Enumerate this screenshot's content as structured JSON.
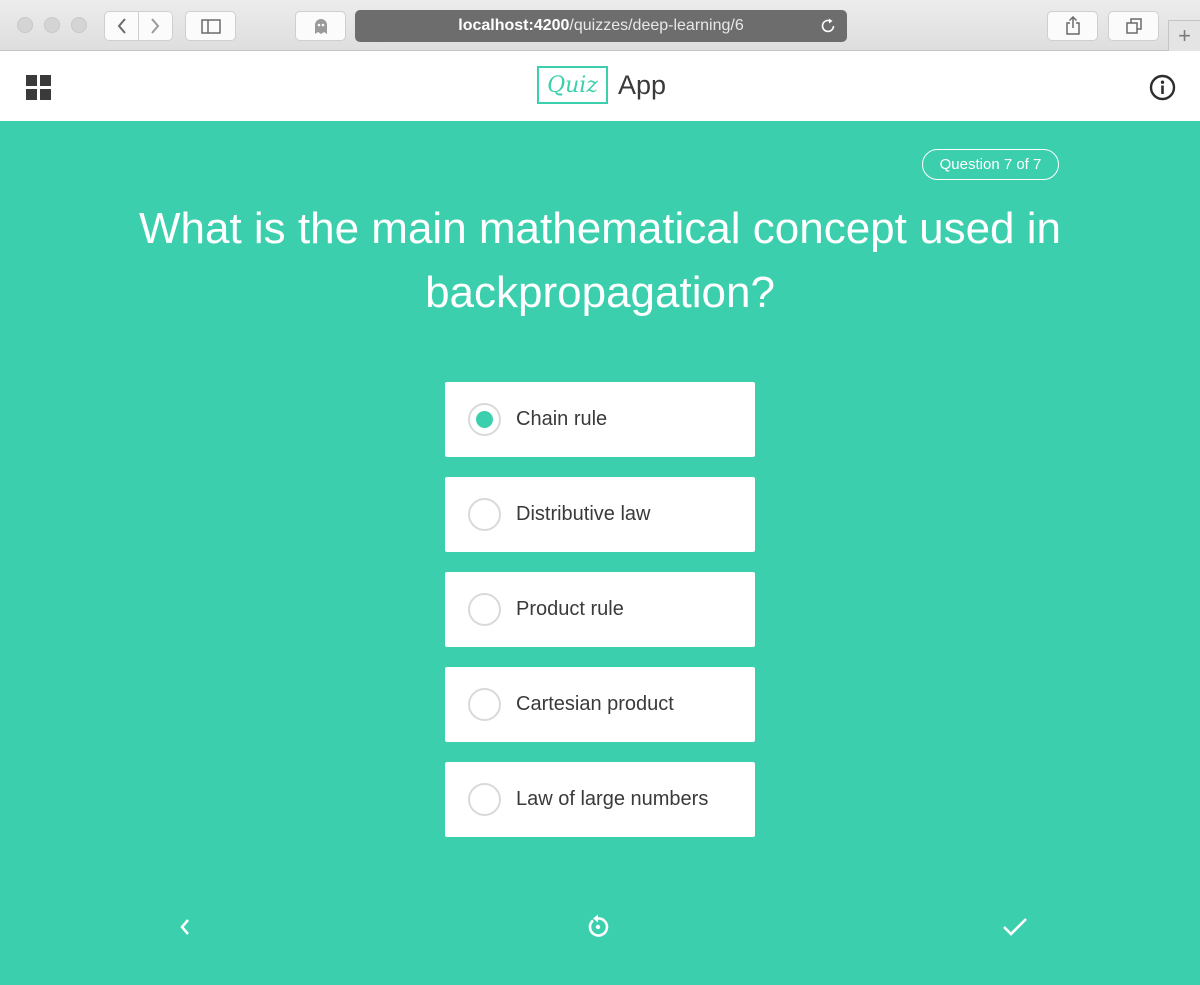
{
  "browser": {
    "url_host": "localhost:4200",
    "url_path": "/quizzes/deep-learning/6",
    "icons": [
      "back-icon",
      "forward-icon",
      "sidebar-icon",
      "ghost-icon",
      "reload-icon",
      "share-icon",
      "tabs-icon",
      "plus-icon"
    ]
  },
  "header": {
    "brand_logo_text": "Quiz",
    "brand_app_text": "App",
    "menu_icon": "grid-icon",
    "info_icon": "info-icon"
  },
  "quiz": {
    "progress_label": "Question 7 of 7",
    "question": "What is the main mathematical concept used in backpropagation?",
    "options": [
      {
        "label": "Chain rule",
        "selected": true
      },
      {
        "label": "Distributive law",
        "selected": false
      },
      {
        "label": "Product rule",
        "selected": false
      },
      {
        "label": "Cartesian product",
        "selected": false
      },
      {
        "label": "Law of large numbers",
        "selected": false
      }
    ]
  },
  "footer": {
    "icons": [
      "chevron-left-icon",
      "restart-icon",
      "check-icon"
    ]
  },
  "colors": {
    "accent": "#3ccfad",
    "text_dark": "#3a3a3a",
    "white": "#ffffff"
  }
}
